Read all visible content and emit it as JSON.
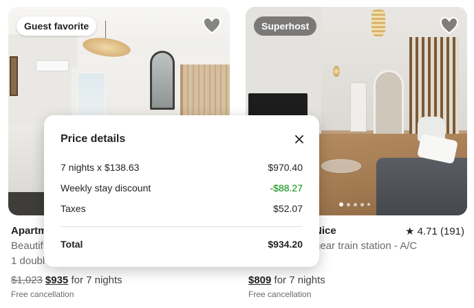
{
  "listings": [
    {
      "badge": "Guest favorite",
      "title": "Apartm",
      "subtitle_1": "Beautif",
      "subtitle_2": "1 doubl",
      "old_price": "$1,023",
      "price": "$935",
      "for_nights": "for 7 nights",
      "cancellation": "Free cancellation",
      "heart_icon": "heart-outline-icon"
    },
    {
      "badge": "Superhost",
      "title": "Nice",
      "subtitle_1": "near train station - A/C",
      "rating": "★ 4.71 (191)",
      "price": "$809",
      "for_nights": "for 7 nights",
      "cancellation": "Free cancellation",
      "heart_icon": "heart-outline-icon",
      "carousel": {
        "count": 5,
        "active": 0
      }
    }
  ],
  "price_details": {
    "title": "Price details",
    "close_icon": "close-icon",
    "rows": [
      {
        "label": "7 nights x $138.63",
        "amount": "$970.40"
      },
      {
        "label": "Weekly stay discount",
        "amount": "-$88.27"
      },
      {
        "label": "Taxes",
        "amount": "$52.07"
      }
    ],
    "total_label": "Total",
    "total_amount": "$934.20"
  },
  "colors": {
    "text": "#222222",
    "muted": "#6a6a6a",
    "discount": "#008a05",
    "divider": "#dddddd"
  }
}
